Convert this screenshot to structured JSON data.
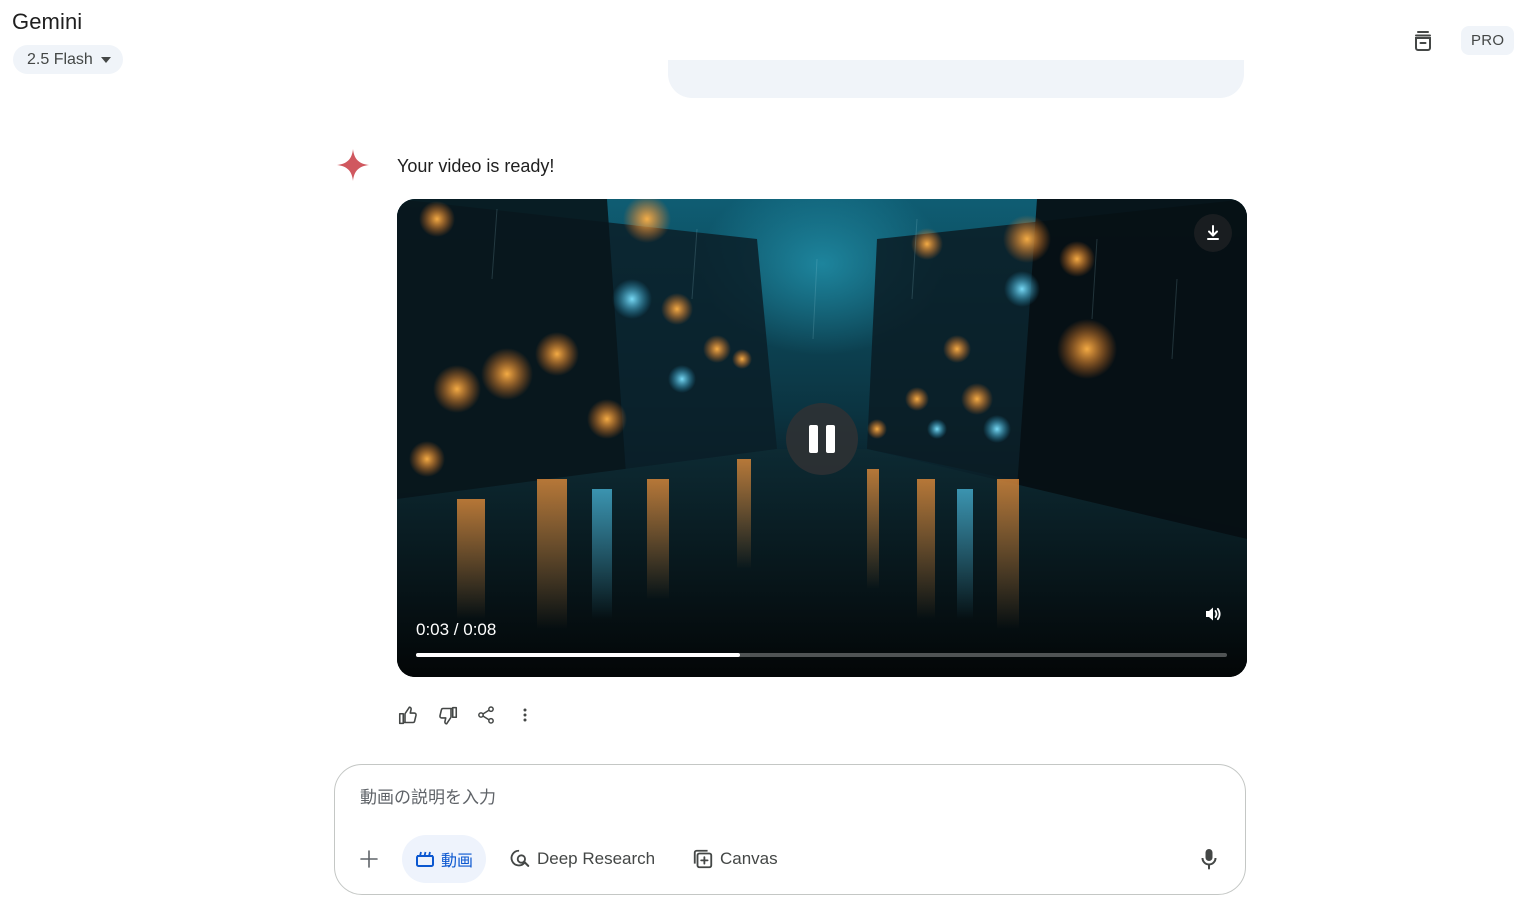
{
  "header": {
    "app_title": "Gemini",
    "model_label": "2.5 Flash",
    "pro_badge": "PRO"
  },
  "response": {
    "text": "Your video is ready!",
    "video": {
      "time_display": "0:03 / 0:08",
      "progress": 0.4,
      "state": "playing"
    }
  },
  "actions": {
    "items": [
      "thumbs-up-icon",
      "thumbs-down-icon",
      "share-icon",
      "more-vert-icon"
    ]
  },
  "input": {
    "placeholder": "動画の説明を入力",
    "value": "",
    "chips": {
      "video_label": "動画",
      "research_label": "Deep Research",
      "canvas_label": "Canvas"
    }
  },
  "colors": {
    "accent": "#0b57d0",
    "spark": "#d0585f",
    "surface": "#f0f4f9"
  }
}
